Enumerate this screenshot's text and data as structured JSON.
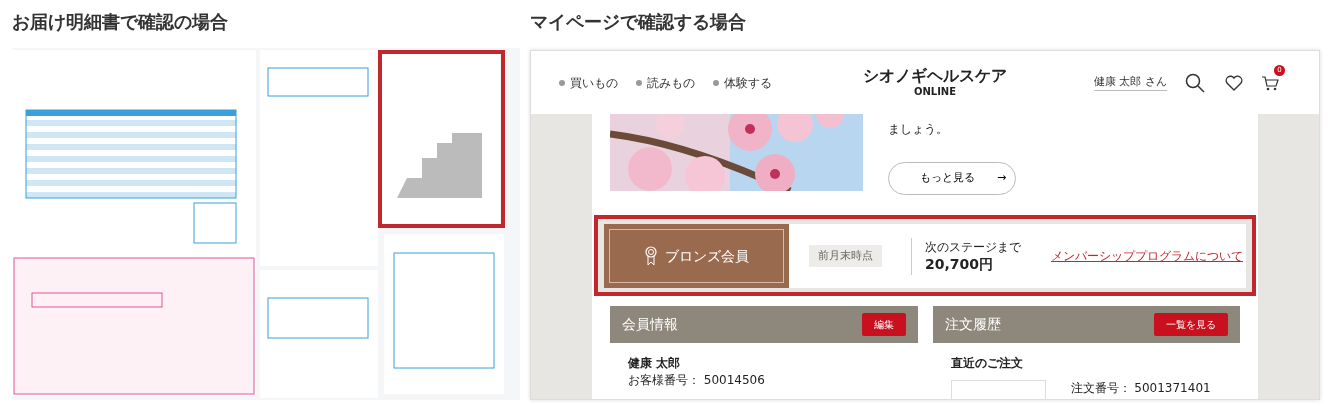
{
  "left_panel": {
    "title": "お届け明細書で確認の場合"
  },
  "right_panel": {
    "title": "マイページで確認する場合",
    "header": {
      "nav": [
        "買いもの",
        "読みもの",
        "体験する"
      ],
      "logo": "シオノギヘルスケア",
      "logo_sub": "ONLINE",
      "user": "健康 太郎 さん",
      "cart_count": "0"
    },
    "feature": {
      "text": "ましょう。",
      "button": "もっと見る",
      "button_icon": "→"
    },
    "membership": {
      "rank": "ブロンズ会員",
      "as_of": "前月末時点",
      "next_label": "次のステージまで",
      "next_amount": "20,700円",
      "link": "メンバーシッププログラムについて"
    },
    "panels": [
      {
        "kind": "member",
        "title": "会員情報",
        "button": "編集",
        "name": "健康 太郎",
        "customer_no": "お客様番号： 50014506"
      },
      {
        "kind": "orders",
        "title": "注文履歴",
        "button": "一覧を見る",
        "subtitle": "直近のご注文",
        "order_no": "注文番号： 5001371401"
      }
    ]
  }
}
